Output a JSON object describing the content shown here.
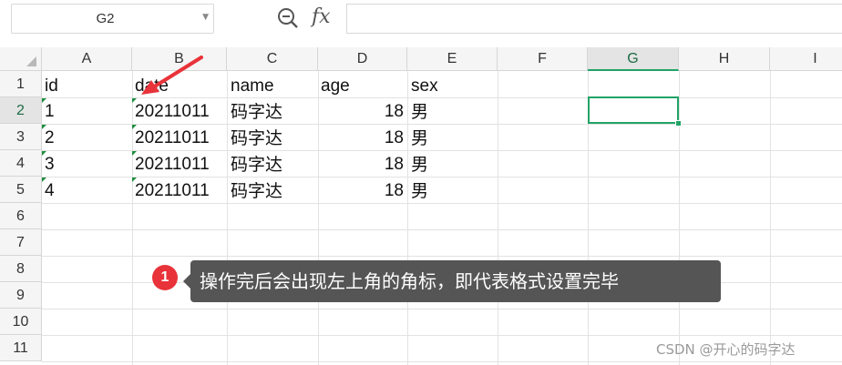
{
  "name_box": "G2",
  "icons": {
    "zoom": "zoom-search-icon",
    "fx": "fx-function-icon",
    "dropdown": "chevron-down-icon"
  },
  "fx_label": "fx",
  "formula_value": "",
  "columns": [
    "A",
    "B",
    "C",
    "D",
    "E",
    "F",
    "G",
    "H",
    "I"
  ],
  "selected_column": "G",
  "rows": [
    "1",
    "2",
    "3",
    "4",
    "5",
    "6",
    "7",
    "8",
    "9",
    "10",
    "11"
  ],
  "selected_row": "2",
  "selected_cell": "G2",
  "cells": {
    "header": {
      "id": "id",
      "date": "date",
      "name": "name",
      "age": "age",
      "sex": "sex"
    },
    "data": [
      {
        "id": "1",
        "date": "20211011",
        "name": "码字达",
        "age": "18",
        "sex": "男"
      },
      {
        "id": "2",
        "date": "20211011",
        "name": "码字达",
        "age": "18",
        "sex": "男"
      },
      {
        "id": "3",
        "date": "20211011",
        "name": "码字达",
        "age": "18",
        "sex": "男"
      },
      {
        "id": "4",
        "date": "20211011",
        "name": "码字达",
        "age": "18",
        "sex": "男"
      }
    ]
  },
  "annotation": {
    "badge": "1",
    "text": "操作完后会出现左上角的角标，即代表格式设置完毕"
  },
  "watermark": "CSDN @开心的码字达",
  "colors": {
    "selection": "#21a366",
    "badge": "#e8333a",
    "tooltip_bg": "#555555",
    "error_flag": "#1e8e3e"
  }
}
